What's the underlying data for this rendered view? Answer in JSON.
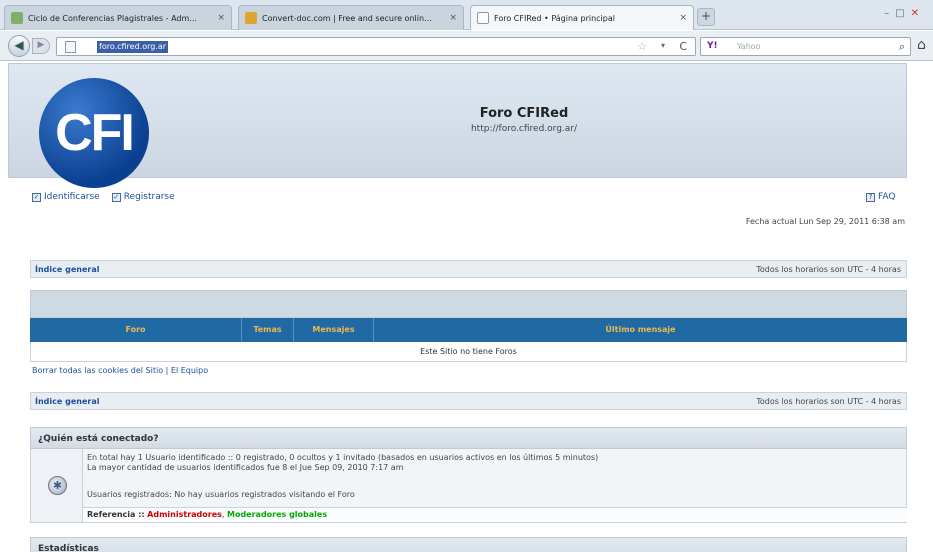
{
  "browser": {
    "tabs": [
      {
        "title": "Ciclo de Conferencias Plagistrales - Adm...",
        "close": "×",
        "active": false
      },
      {
        "title": "Convert-doc.com | Free and secure onlin...",
        "close": "×",
        "active": false
      },
      {
        "title": "Foro CFIRed • Página principal",
        "close": "×",
        "active": true
      }
    ],
    "newtab_label": "+",
    "url": "foro.cfired.org.ar",
    "search_engine": "Y!",
    "search_placeholder": "Yahoo",
    "colors": {
      "tab_bar": "#dde5ee",
      "url_highlight": "#3b5ea8"
    }
  },
  "header": {
    "logo_text": "CFI",
    "title": "Foro CFIRed",
    "url": "http://foro.cfired.org.ar/",
    "colors": {
      "logo": "#0b3f8f",
      "band": "#cbd6e2"
    }
  },
  "userlinks": {
    "login": "Identificarse",
    "register": "Registrarse",
    "faq": "FAQ"
  },
  "current_date": "Fecha actual Lun Sep 29, 2011 6:38 am",
  "nav_top": {
    "index": "Índice general",
    "timezone": "Todos los horarios son UTC - 4 horas"
  },
  "forum_table": {
    "columns": [
      "Foro",
      "Temas",
      "Mensajes",
      "Último mensaje"
    ],
    "empty_message": "Este Sitio no tiene Foros",
    "colors": {
      "header_bg": "#1f6aa5",
      "header_text": "#f0b84c"
    }
  },
  "footer_links": "Borrar todas las cookies del Sitio | El Equipo",
  "nav_bottom": {
    "index": "Índice general",
    "timezone": "Todos los horarios son UTC - 4 horas"
  },
  "who_online": {
    "title": "¿Quién está conectado?",
    "line1": "En total hay 1 Usuario identificado :: 0 registrado, 0 ocultos y 1 invitado (basados en usuarios activos en los últimos 5 minutos)",
    "line2": "La mayor cantidad de usuarios identificados fue 8 el Jue Sep 09, 2010 7:17 am",
    "registered": "Usuarios registrados: No hay usuarios registrados visitando el Foro",
    "legend_label": "Referencia ::",
    "admins": "Administradores",
    "separator": ",",
    "mods": "Moderadores globales",
    "colors": {
      "admins": "#cc0000",
      "mods": "#00aa00"
    }
  },
  "stats": {
    "title": "Estadísticas"
  }
}
